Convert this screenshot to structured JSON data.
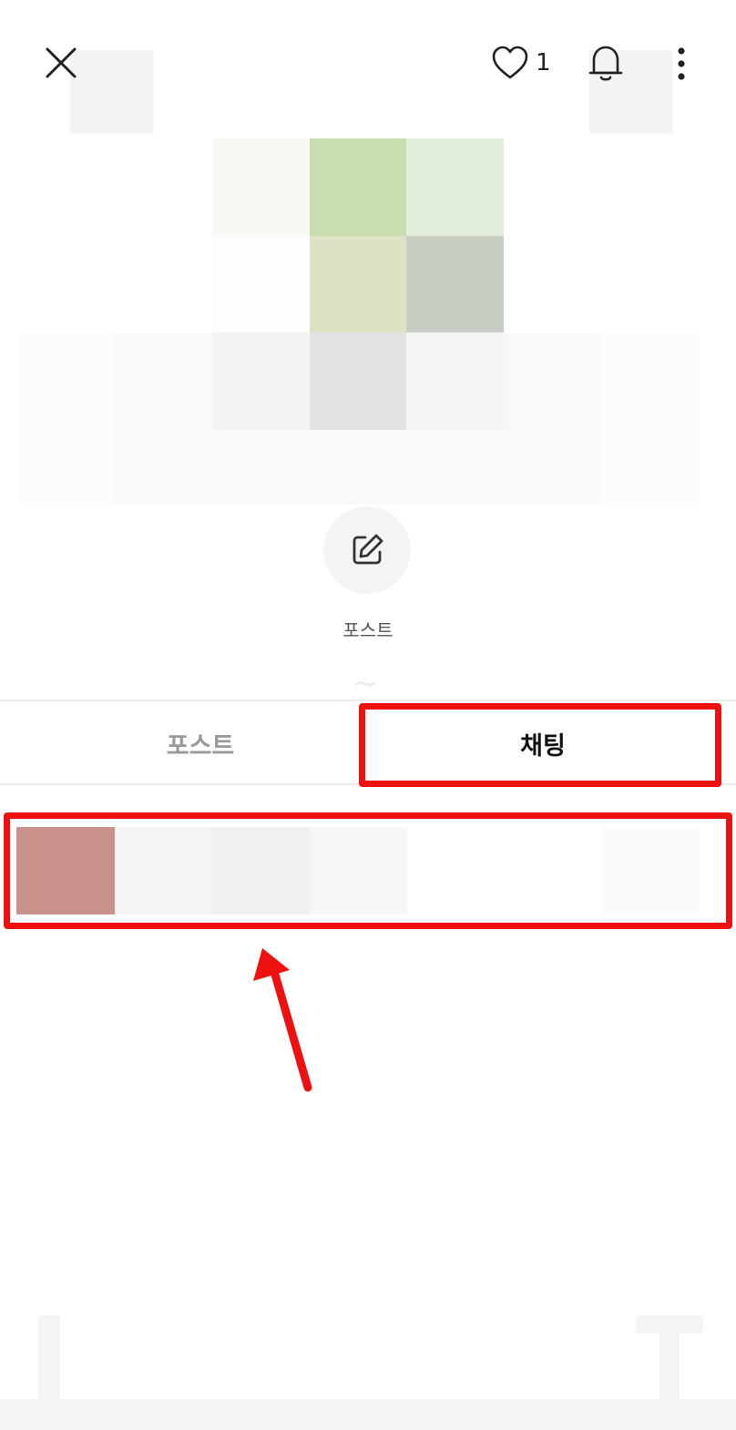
{
  "header": {
    "close_icon": "close-icon",
    "like_icon": "heart-outline-icon",
    "like_count": "1",
    "bell_icon": "bell-icon",
    "more_icon": "more-vertical-icon"
  },
  "profile": {
    "mosaic_colors": [
      "#f8f9f4",
      "#c9deaf",
      "#e2eed9",
      "#fdfdfd",
      "#dde2c3",
      "#c7cec3",
      "#f3f3f3",
      "#e2e2e2",
      "#f4f4f4"
    ]
  },
  "post_action": {
    "icon": "edit-icon",
    "label": "포스트"
  },
  "tabs": [
    {
      "label": "포스트",
      "active": false
    },
    {
      "label": "채팅",
      "active": true
    }
  ],
  "chat_list": {
    "avatar_color": "#c8928a",
    "segment_colors": [
      "#f4f4f4",
      "#f0f0f0",
      "#f6f6f6",
      "#ffffff",
      "#ffffff",
      "#fafafa"
    ]
  },
  "highlight_color": "#ee1111"
}
